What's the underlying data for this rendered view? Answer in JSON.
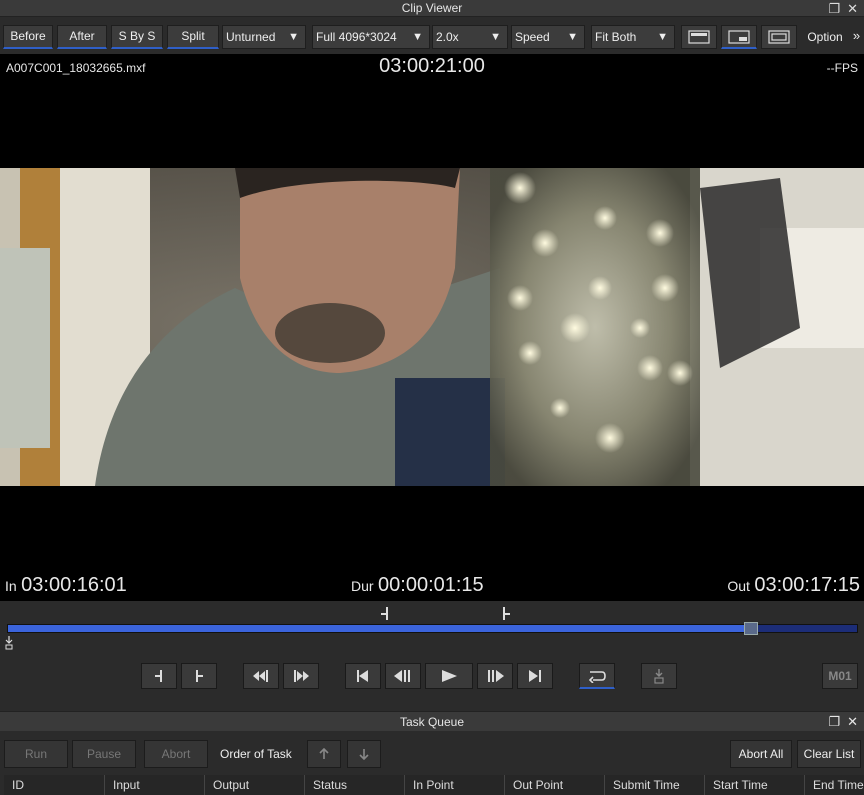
{
  "window": {
    "title": "Clip Viewer"
  },
  "toolbar": {
    "before": "Before",
    "after": "After",
    "sbys": "S By S",
    "split": "Split",
    "unturned": "Unturned",
    "resolution": "Full 4096*3024",
    "zoom": "2.0x",
    "speed": "Speed",
    "fit": "Fit Both",
    "option": "Option"
  },
  "viewer": {
    "filename": "A007C001_18032665.mxf",
    "timecode": "03:00:21:00",
    "fps": "--FPS",
    "in_label": "In",
    "in_value": "03:00:16:01",
    "dur_label": "Dur",
    "dur_value": "00:00:01:15",
    "out_label": "Out",
    "out_value": "03:00:17:15"
  },
  "scrubber": {
    "progress": 0.875
  },
  "transport": {
    "m01": "M01"
  },
  "task_queue": {
    "title": "Task Queue",
    "run": "Run",
    "pause": "Pause",
    "abort": "Abort",
    "order_label": "Order of Task",
    "abort_all": "Abort All",
    "clear_list": "Clear List",
    "columns": [
      "ID",
      "Input",
      "Output",
      "Status",
      "In Point",
      "Out Point",
      "Submit Time",
      "Start Time",
      "End Time"
    ]
  }
}
